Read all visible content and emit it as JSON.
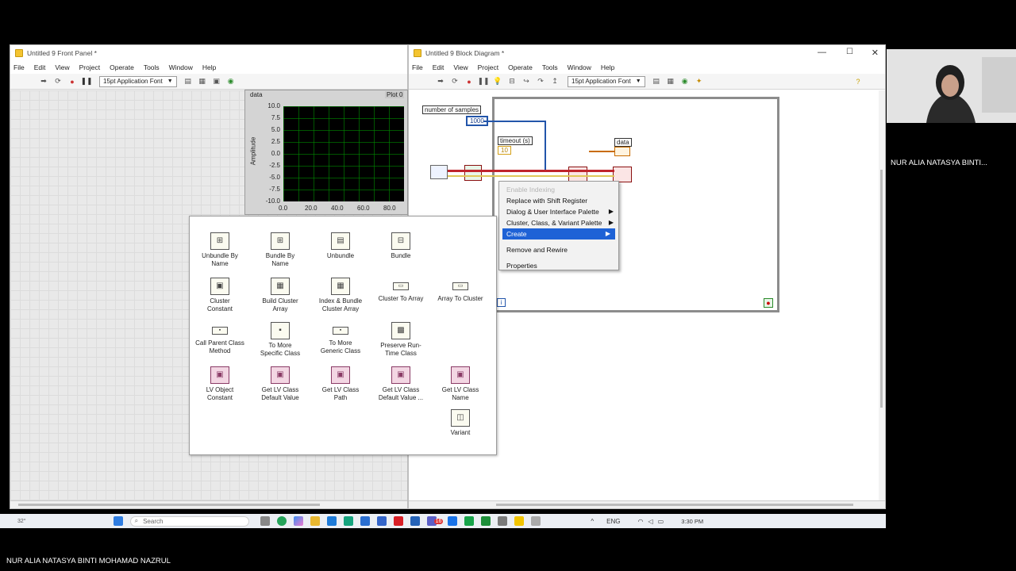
{
  "front_panel": {
    "title": "Untitled 9 Front Panel *",
    "menu": [
      "File",
      "Edit",
      "View",
      "Project",
      "Operate",
      "Tools",
      "Window",
      "Help"
    ],
    "font": "15pt Application Font"
  },
  "graph": {
    "label": "data",
    "plot_legend": "Plot 0",
    "ylabel": "Amplitude",
    "yticks": [
      "10.0",
      "7.5",
      "5.0",
      "2.5",
      "0.0",
      "-2.5",
      "-5.0",
      "-7.5",
      "-10.0"
    ],
    "xticks": [
      "0.0",
      "20.0",
      "40.0",
      "60.0",
      "80.0"
    ]
  },
  "block_diagram": {
    "title": "Untitled 9 Block Diagram *",
    "menu": [
      "File",
      "Edit",
      "View",
      "Project",
      "Operate",
      "Tools",
      "Window",
      "Help"
    ],
    "font": "15pt Application Font",
    "window_controls": [
      "—",
      "☐",
      "✕"
    ]
  },
  "diagram": {
    "samples_label": "number of samples",
    "samples_value": "1000",
    "timeout_label": "timeout (s)",
    "timeout_value": "10",
    "data_label": "data",
    "loop_index": "i"
  },
  "context_menu": {
    "items": [
      {
        "label": "Enable Indexing",
        "state": "disabled"
      },
      {
        "label": "Replace with Shift Register",
        "state": "normal"
      },
      {
        "label": "Dialog & User Interface Palette",
        "state": "submenu"
      },
      {
        "label": "Cluster, Class, & Variant Palette",
        "state": "submenu"
      },
      {
        "label": "Create",
        "state": "selected"
      },
      {
        "label": "Remove and Rewire",
        "state": "normal"
      },
      {
        "label": "Properties",
        "state": "normal"
      }
    ]
  },
  "palette": {
    "items": [
      [
        "Unbundle By",
        "Name"
      ],
      [
        "Bundle By",
        "Name"
      ],
      [
        "Unbundle",
        ""
      ],
      [
        "Bundle",
        ""
      ],
      [
        "Cluster",
        "Constant"
      ],
      [
        "Build Cluster",
        "Array"
      ],
      [
        "Index & Bundle",
        "Cluster Array"
      ],
      [
        "Cluster To Array",
        ""
      ],
      [
        "Array To Cluster",
        ""
      ],
      [
        "Call Parent Class",
        "Method"
      ],
      [
        "To More",
        "Specific Class"
      ],
      [
        "To More",
        "Generic Class"
      ],
      [
        "Preserve Run-",
        "Time Class"
      ],
      [
        "LV Object",
        "Constant"
      ],
      [
        "Get LV Class",
        "Default Value"
      ],
      [
        "Get LV Class",
        "Path"
      ],
      [
        "Get LV Class",
        "Default Value ..."
      ],
      [
        "Get LV Class",
        "Name"
      ],
      [
        "Variant",
        ""
      ]
    ]
  },
  "taskbar": {
    "weather": "32°",
    "search_placeholder": "Search",
    "badge": "16",
    "lang": "ENG",
    "time": "3:30 PM"
  },
  "participant": {
    "name": "NUR ALIA NATASYA BINTI..."
  },
  "presenter": {
    "name": "NUR ALIA NATASYA BINTI MOHAMAD NAZRUL"
  },
  "colors": {
    "selection": "#1e62d6",
    "graph_bg": "#000000",
    "graph_grid": "#008c00",
    "wire_blue": "#2255aa",
    "wire_red": "#c0242c"
  }
}
